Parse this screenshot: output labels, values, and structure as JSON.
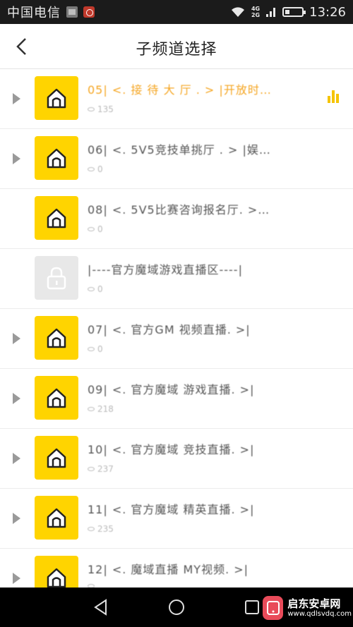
{
  "status_bar": {
    "carrier": "中国电信",
    "network_top": "4G",
    "network_bottom": "2G",
    "time": "13:26"
  },
  "header": {
    "title": "子频道选择"
  },
  "channels": [
    {
      "name": "05|  <. 接 待 大 厅 . > |开放时…",
      "viewers": "135",
      "expandable": true,
      "locked": false,
      "active": true
    },
    {
      "name": "06|  <. 5V5竞技单挑厅 . > |娱…",
      "viewers": "0",
      "expandable": true,
      "locked": false,
      "active": false
    },
    {
      "name": "08|  <. 5V5比赛咨询报名厅. >…",
      "viewers": "0",
      "expandable": false,
      "locked": false,
      "active": false
    },
    {
      "name": "|----官方魔域游戏直播区----|",
      "viewers": "0",
      "expandable": false,
      "locked": true,
      "active": false
    },
    {
      "name": "07|  <. 官方GM 视频直播. >|",
      "viewers": "0",
      "expandable": true,
      "locked": false,
      "active": false
    },
    {
      "name": "09|  <. 官方魔域 游戏直播. >|",
      "viewers": "218",
      "expandable": true,
      "locked": false,
      "active": false
    },
    {
      "name": "10|  <. 官方魔域 竞技直播. >|",
      "viewers": "237",
      "expandable": true,
      "locked": false,
      "active": false
    },
    {
      "name": "11|  <. 官方魔域 精英直播. >|",
      "viewers": "235",
      "expandable": true,
      "locked": false,
      "active": false
    },
    {
      "name": "12|  <. 魔域直播 MY视频. >|",
      "viewers": "",
      "expandable": true,
      "locked": false,
      "active": false
    }
  ],
  "watermark": {
    "title": "启东安卓网",
    "url": "www.qdlsvdq.com"
  },
  "colors": {
    "accent": "#f5a623",
    "avatar": "#ffd400",
    "status_bar": "#1b1b1b"
  }
}
